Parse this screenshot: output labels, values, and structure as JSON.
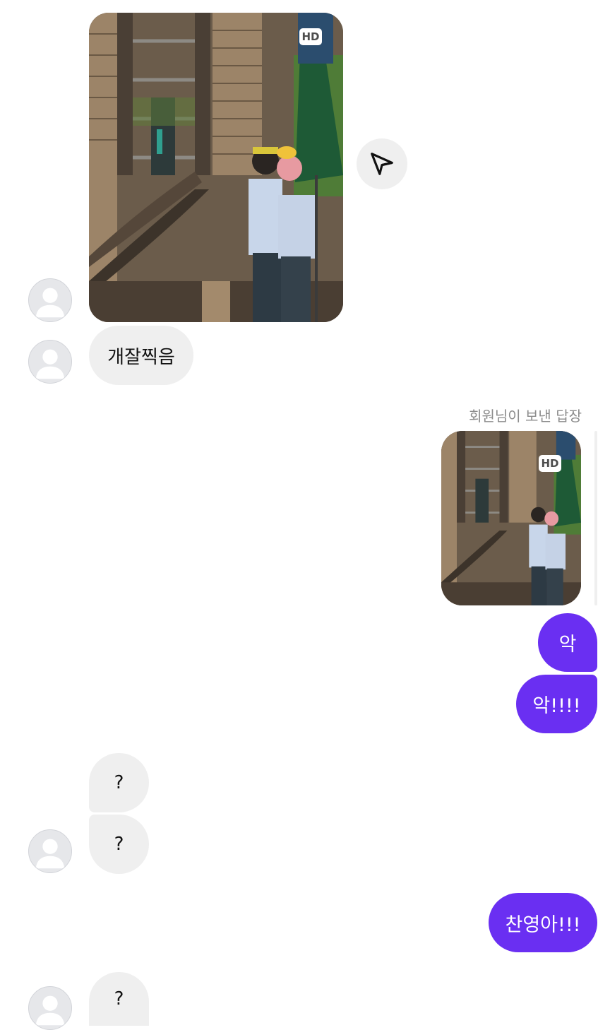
{
  "photo_badge": "HD",
  "incoming": {
    "msg1_text": "개잘찍음",
    "q1": "?",
    "q2": "?",
    "q3": "?"
  },
  "reply_label": "회원님이 보낸 답장",
  "outgoing": {
    "msg1": "악",
    "msg2": "악!!!!",
    "msg3": "찬영아!!!"
  },
  "colors": {
    "outgoing_bubble": "#6a2ff2",
    "incoming_bubble": "#efefef",
    "background": "#ffffff"
  },
  "icons": {
    "share": "paper-plane-icon",
    "avatar": "default-profile-icon"
  }
}
